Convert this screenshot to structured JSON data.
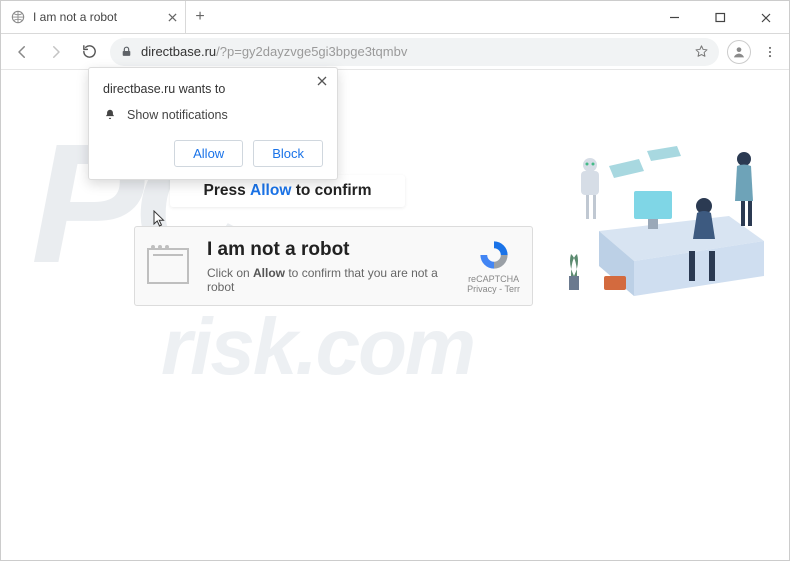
{
  "window": {
    "tab_title": "I am not a robot",
    "newtab_label": "+"
  },
  "toolbar": {
    "url_host": "directbase.ru",
    "url_path": "/?p=gy2dayzvge5gi3bpge3tqmbv"
  },
  "permission_popup": {
    "title": "directbase.ru wants to",
    "line": "Show notifications",
    "allow": "Allow",
    "block": "Block"
  },
  "banner": {
    "pre": "Press ",
    "highlight": "Allow",
    "post": " to confirm"
  },
  "card": {
    "heading": "I am not a robot",
    "sub_pre": "Click on ",
    "sub_bold": "Allow",
    "sub_post": " to confirm that you are not a robot"
  },
  "recaptcha": {
    "label": "reCAPTCHA",
    "privacy": "Privacy",
    "terms": "Terr"
  },
  "watermark": {
    "big": "PC",
    "small": "risk.com"
  }
}
